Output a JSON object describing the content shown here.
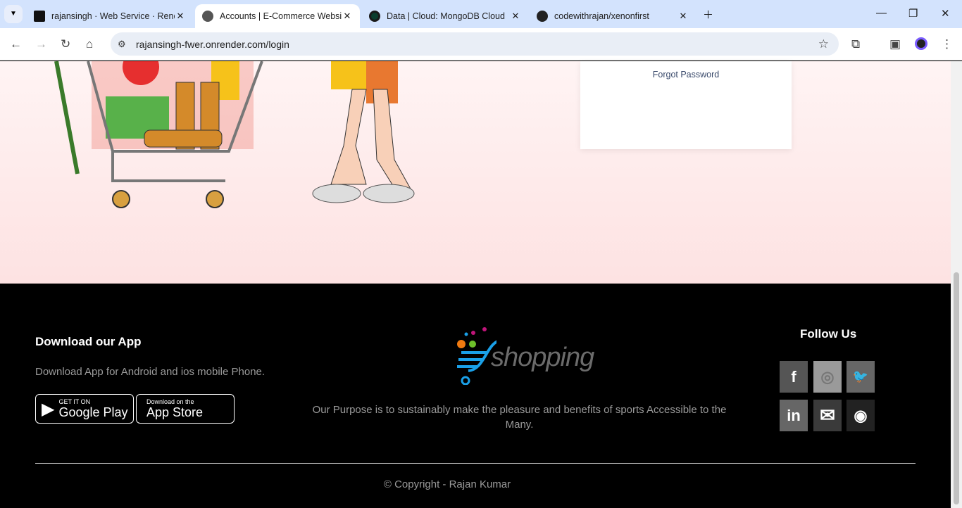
{
  "browser": {
    "tabs": [
      {
        "title": "rajansingh · Web Service · Render",
        "icon": "render-icon",
        "active": false
      },
      {
        "title": "Accounts | E-Commerce Website",
        "icon": "globe-icon",
        "active": true
      },
      {
        "title": "Data | Cloud: MongoDB Cloud",
        "icon": "mongodb-leaf-icon",
        "active": false
      },
      {
        "title": "codewithrajan/xenonfirst",
        "icon": "github-icon",
        "active": false
      }
    ],
    "url": "rajansingh-fwer.onrender.com/login"
  },
  "login": {
    "forgot_password": "Forgot Password"
  },
  "footer": {
    "download_title": "Download our App",
    "download_text": "Download App for Android and ios mobile Phone.",
    "google_play": {
      "small": "GET IT ON",
      "big": "Google Play"
    },
    "app_store": {
      "small": "Download on the",
      "big": "App Store"
    },
    "logo_text": "shopping",
    "purpose": "Our Purpose is to sustainably make the pleasure and benefits of sports Accessible to the Many.",
    "follow_title": "Follow Us",
    "social": [
      {
        "name": "facebook",
        "glyph": "f",
        "color": "#555555"
      },
      {
        "name": "instagram",
        "glyph": "◎",
        "color": "#9a9a9a"
      },
      {
        "name": "twitter",
        "glyph": "🐦",
        "color": "#666666"
      },
      {
        "name": "linkedin",
        "glyph": "in",
        "color": "#666666"
      },
      {
        "name": "email",
        "glyph": "✉",
        "color": "#3a3a3a"
      },
      {
        "name": "github",
        "glyph": "◉",
        "color": "#222222"
      }
    ],
    "copyright": "© Copyright - Rajan Kumar"
  }
}
